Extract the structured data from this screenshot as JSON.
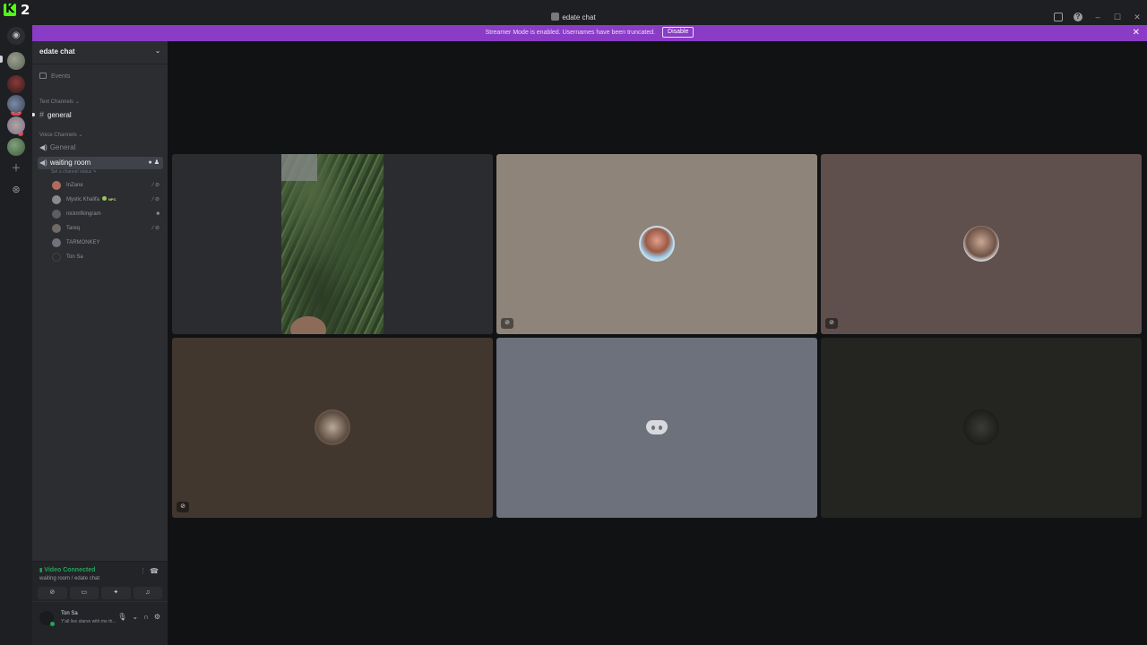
{
  "titlebar": {
    "kick_count": "2",
    "window_title": "edate chat"
  },
  "banner": {
    "text": "Streamer Mode is enabled. Usernames have been truncated.",
    "button": "Disable"
  },
  "rail": {
    "badge": "122"
  },
  "server": {
    "name": "edate chat",
    "events_label": "Events",
    "text_category": "Text Channels",
    "text_channel": "general",
    "voice_category": "Voice Channels",
    "voice_general": "General",
    "active_voice": "waiting room",
    "status_hint": "Set a channel status",
    "voice_users": [
      {
        "name": "InZane"
      },
      {
        "name": "Mystic Khalifa",
        "badge": "NPC"
      },
      {
        "name": "nickmfkingram"
      },
      {
        "name": "Tareq"
      },
      {
        "name": "TARMONKEY"
      },
      {
        "name": "Ton Sa"
      }
    ]
  },
  "voice_panel": {
    "status": "Video Connected",
    "location": "waiting room / edate chat"
  },
  "user_bar": {
    "name": "Ton Sa",
    "status": "Y'all live starve with me th..."
  },
  "colors": {
    "banner": "#8a3cc6",
    "connected": "#23a559",
    "sidebar": "#2b2d31",
    "background": "#111214"
  }
}
